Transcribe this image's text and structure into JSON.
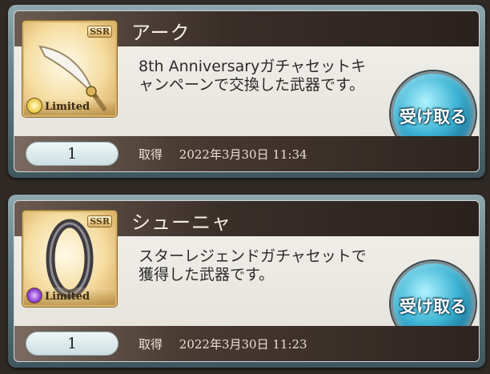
{
  "items": [
    {
      "name": "アーク",
      "rarity": "SSR",
      "badge": "Limited",
      "element": "light",
      "description": "8th Anniversaryガチャセットキャンペーンで交換した武器です。",
      "quantity": "1",
      "acquired_label": "取得",
      "acquired_date": "2022年3月30日 11:34",
      "button_label": "受け取る"
    },
    {
      "name": "シューニャ",
      "rarity": "SSR",
      "badge": "Limited",
      "element": "dark",
      "description": "スターレジェンドガチャセットで獲得した武器です。",
      "quantity": "1",
      "acquired_label": "取得",
      "acquired_date": "2022年3月30日 11:23",
      "button_label": "受け取る"
    }
  ],
  "colors": {
    "button_blue": "#3fb4d4",
    "title_bar": "#3a2e29",
    "card_frame": "#5e7880",
    "thumb_gold": "#d6a657"
  },
  "icons": [
    "scimitar-weapon-icon",
    "ring-weapon-icon",
    "light-element-icon",
    "dark-element-icon"
  ]
}
